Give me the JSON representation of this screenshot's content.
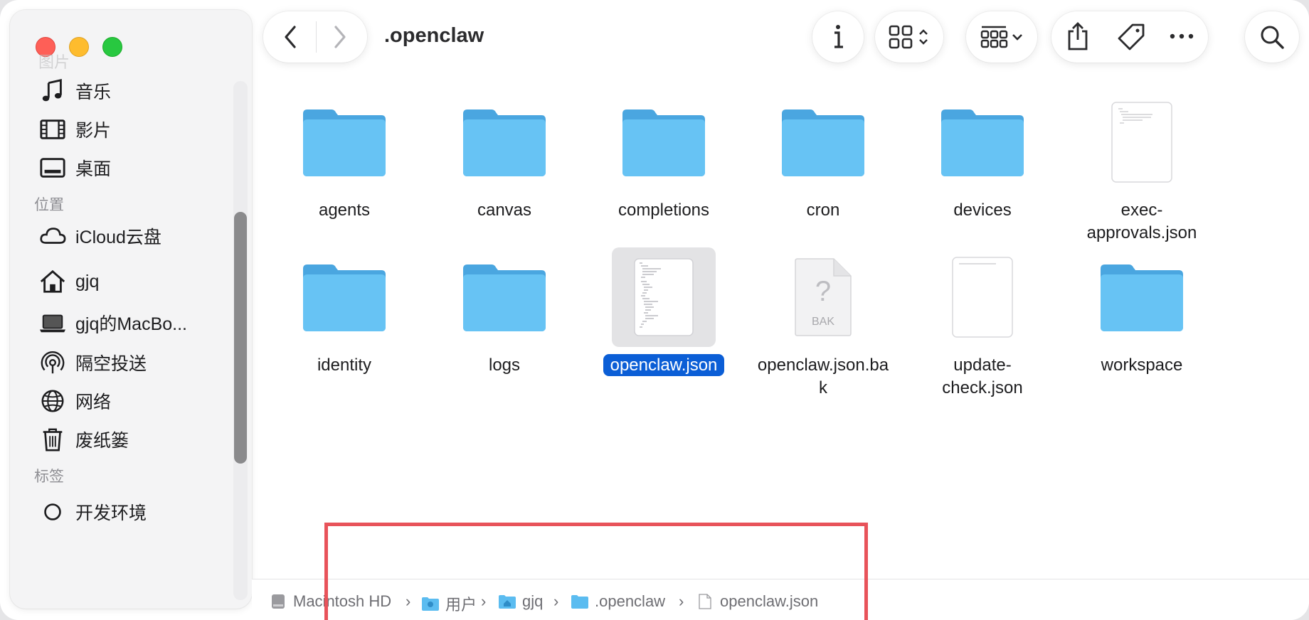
{
  "window": {
    "title": ".openclaw"
  },
  "sidebar": {
    "ghost_label": "图片",
    "items": [
      {
        "label": "音乐",
        "icon": "music-icon"
      },
      {
        "label": "影片",
        "icon": "film-icon"
      },
      {
        "label": "桌面",
        "icon": "desktop-icon"
      }
    ],
    "section_locations": "位置",
    "locations": [
      {
        "label": "iCloud云盘",
        "icon": "cloud-icon"
      },
      {
        "label": "gjq",
        "icon": "home-icon"
      },
      {
        "label": "gjq的MacBo...",
        "icon": "laptop-icon"
      },
      {
        "label": "隔空投送",
        "icon": "airdrop-icon"
      },
      {
        "label": "网络",
        "icon": "network-icon"
      },
      {
        "label": "废纸篓",
        "icon": "trash-icon"
      }
    ],
    "section_tags": "标签",
    "tags": [
      {
        "label": "开发环境",
        "icon": "tag-circle-icon"
      }
    ]
  },
  "toolbar": {
    "back": "chevron-left-icon",
    "forward": "chevron-right-icon",
    "info": "info-icon",
    "view": "grid-view-icon",
    "group": "group-icon",
    "share": "share-icon",
    "tag": "tag-icon",
    "more": "more-icon",
    "search": "search-icon"
  },
  "files": [
    {
      "name": "agents",
      "kind": "folder"
    },
    {
      "name": "canvas",
      "kind": "folder"
    },
    {
      "name": "completions",
      "kind": "folder"
    },
    {
      "name": "cron",
      "kind": "folder"
    },
    {
      "name": "devices",
      "kind": "folder"
    },
    {
      "name": "exec-approvals.json",
      "kind": "json",
      "line1": "exec-",
      "line2": "approvals.json"
    },
    {
      "name": "identity",
      "kind": "folder"
    },
    {
      "name": "logs",
      "kind": "folder"
    },
    {
      "name": "openclaw.json",
      "kind": "json",
      "selected": true
    },
    {
      "name": "openclaw.json.bak",
      "kind": "bak",
      "line1": "openclaw.json.ba",
      "line2": "k",
      "badge": "BAK",
      "glyph": "?"
    },
    {
      "name": "update-check.json",
      "kind": "json",
      "line1": "update-",
      "line2": "check.json"
    },
    {
      "name": "workspace",
      "kind": "folder"
    }
  ],
  "pathbar": {
    "crumbs": [
      "Macintosh HD",
      "用户",
      "gjq",
      ".openclaw",
      "openclaw.json"
    ]
  },
  "colors": {
    "folder": "#5bbcf0",
    "selection": "#0b5ed6",
    "highlight_box": "#e8535a"
  }
}
